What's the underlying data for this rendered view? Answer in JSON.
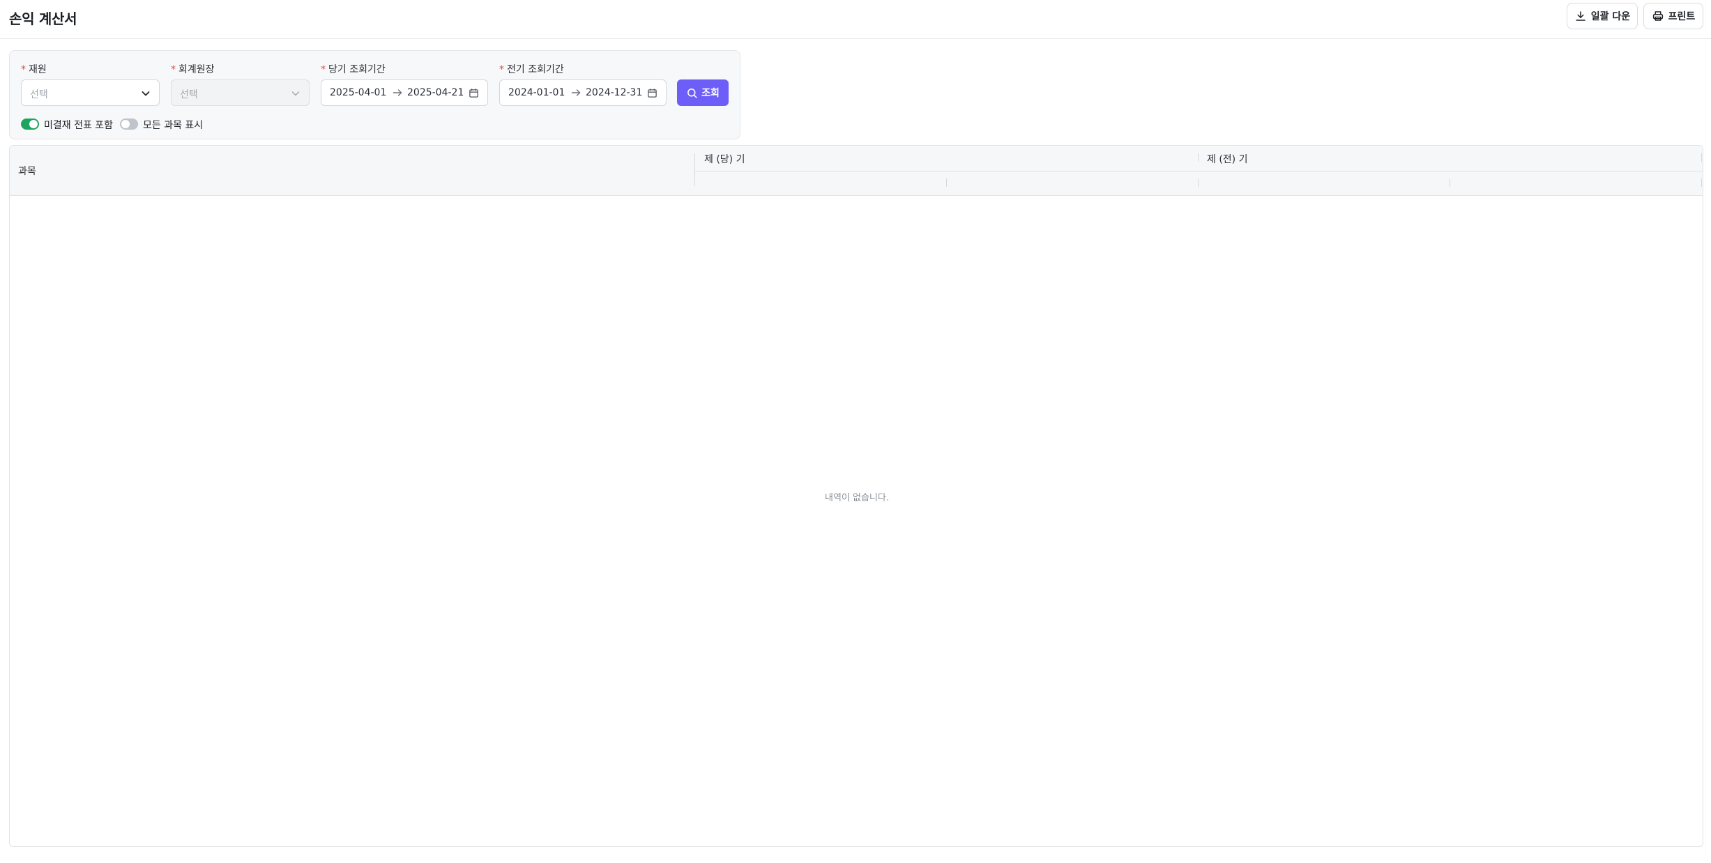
{
  "header": {
    "title": "손익 계산서",
    "download_label": "일괄 다운",
    "print_label": "프린트"
  },
  "filters": {
    "required_mark": "*",
    "resource": {
      "label": "재원",
      "placeholder": "선택"
    },
    "ledger": {
      "label": "회계원장",
      "placeholder": "선택",
      "disabled": true
    },
    "current_period": {
      "label": "당기 조회기간",
      "start": "2025-04-01",
      "end": "2025-04-21"
    },
    "previous_period": {
      "label": "전기 조회기간",
      "start": "2024-01-01",
      "end": "2024-12-31"
    },
    "search_label": "조회",
    "toggles": [
      {
        "label": "미결재 전표 포함",
        "on": true
      },
      {
        "label": "모든 과목 표시",
        "on": false
      }
    ]
  },
  "table": {
    "columns": {
      "account": "과목",
      "current": "제 (당) 기",
      "previous": "제 (전) 기"
    },
    "empty_message": "내역이 없습니다."
  },
  "colors": {
    "accent": "#6d5ef8",
    "toggle_on": "#1fa45f",
    "toggle_off": "#bfc4ca",
    "required": "#e5484d"
  }
}
